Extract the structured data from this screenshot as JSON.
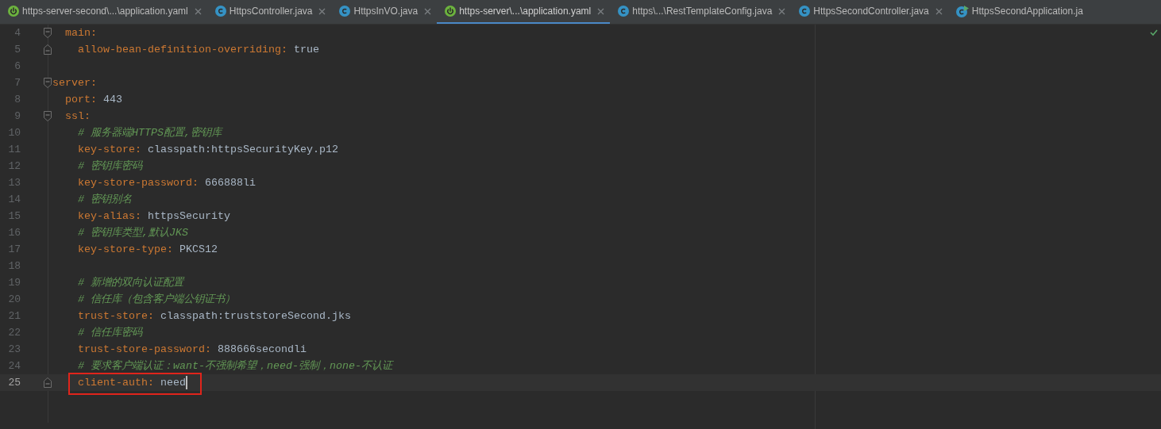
{
  "tabs": [
    {
      "label": "https-server-second\\...\\application.yaml",
      "kind": "spring",
      "selected": false,
      "closable": true
    },
    {
      "label": "HttpsController.java",
      "kind": "class",
      "selected": false,
      "closable": true
    },
    {
      "label": "HttpsInVO.java",
      "kind": "class",
      "selected": false,
      "closable": true
    },
    {
      "label": "https-server\\...\\application.yaml",
      "kind": "spring",
      "selected": true,
      "closable": true
    },
    {
      "label": "https\\...\\RestTemplateConfig.java",
      "kind": "class",
      "selected": false,
      "closable": true
    },
    {
      "label": "HttpsSecondController.java",
      "kind": "class",
      "selected": false,
      "closable": true
    },
    {
      "label": "HttpsSecondApplication.ja",
      "kind": "app",
      "selected": false,
      "closable": false
    }
  ],
  "editor": {
    "inspection_ok": true,
    "lines": [
      {
        "number": "4",
        "key": "  main:",
        "fold_start": true,
        "fold_end": false,
        "current": false,
        "boxed": false
      },
      {
        "number": "5",
        "key": "    allow-bean-definition-overriding:",
        "value": "true",
        "fold_start": false,
        "fold_end": true,
        "current": false,
        "boxed": false
      },
      {
        "number": "6",
        "fold_start": false,
        "fold_end": false,
        "current": false,
        "boxed": false
      },
      {
        "number": "7",
        "key": "server:",
        "fold_start": true,
        "fold_end": false,
        "current": false,
        "boxed": false
      },
      {
        "number": "8",
        "key": "  port:",
        "value": "443",
        "fold_start": false,
        "fold_end": false,
        "current": false,
        "boxed": false
      },
      {
        "number": "9",
        "key": "  ssl:",
        "fold_start": true,
        "fold_end": false,
        "current": false,
        "boxed": false
      },
      {
        "number": "10",
        "comment": "    # 服务器端HTTPS配置,密钥库",
        "fold_start": false,
        "fold_end": false,
        "current": false,
        "boxed": false
      },
      {
        "number": "11",
        "key": "    key-store:",
        "value": "classpath:httpsSecurityKey.p12",
        "fold_start": false,
        "fold_end": false,
        "current": false,
        "boxed": false
      },
      {
        "number": "12",
        "comment": "    # 密钥库密码",
        "fold_start": false,
        "fold_end": false,
        "current": false,
        "boxed": false
      },
      {
        "number": "13",
        "key": "    key-store-password:",
        "value": "666888li",
        "fold_start": false,
        "fold_end": false,
        "current": false,
        "boxed": false
      },
      {
        "number": "14",
        "comment": "    # 密钥别名",
        "fold_start": false,
        "fold_end": false,
        "current": false,
        "boxed": false
      },
      {
        "number": "15",
        "key": "    key-alias:",
        "value": "httpsSecurity",
        "fold_start": false,
        "fold_end": false,
        "current": false,
        "boxed": false
      },
      {
        "number": "16",
        "comment": "    # 密钥库类型,默认JKS",
        "fold_start": false,
        "fold_end": false,
        "current": false,
        "boxed": false
      },
      {
        "number": "17",
        "key": "    key-store-type:",
        "value": "PKCS12",
        "fold_start": false,
        "fold_end": false,
        "current": false,
        "boxed": false
      },
      {
        "number": "18",
        "fold_start": false,
        "fold_end": false,
        "current": false,
        "boxed": false
      },
      {
        "number": "19",
        "comment": "    # 新增的双向认证配置",
        "fold_start": false,
        "fold_end": false,
        "current": false,
        "boxed": false
      },
      {
        "number": "20",
        "comment": "    # 信任库（包含客户端公钥证书）",
        "fold_start": false,
        "fold_end": false,
        "current": false,
        "boxed": false
      },
      {
        "number": "21",
        "key": "    trust-store:",
        "value": "classpath:truststoreSecond.jks",
        "fold_start": false,
        "fold_end": false,
        "current": false,
        "boxed": false
      },
      {
        "number": "22",
        "comment": "    # 信任库密码",
        "fold_start": false,
        "fold_end": false,
        "current": false,
        "boxed": false
      },
      {
        "number": "23",
        "key": "    trust-store-password:",
        "value": "888666secondli",
        "fold_start": false,
        "fold_end": false,
        "current": false,
        "boxed": false
      },
      {
        "number": "24",
        "comment": "    # 要求客户端认证：want-不强制希望，need-强制，none-不认证",
        "fold_start": false,
        "fold_end": false,
        "current": false,
        "boxed": false
      },
      {
        "number": "25",
        "key": "    client-auth:",
        "value": "need",
        "fold_start": false,
        "fold_end": true,
        "current": true,
        "boxed": true
      }
    ]
  }
}
